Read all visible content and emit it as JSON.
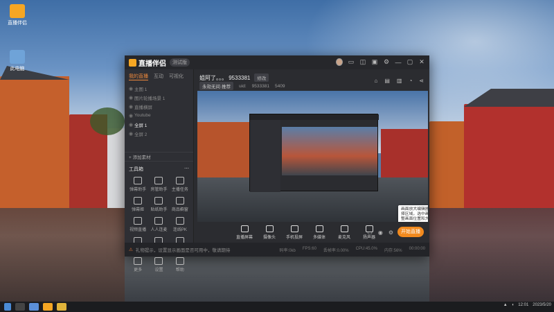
{
  "window": {
    "app_name": "直播伴侣",
    "version_badge": "测试版",
    "tabs": [
      "我的直播",
      "互动",
      "可视化"
    ],
    "scenes": [
      {
        "label": "主图 1",
        "selected": false
      },
      {
        "label": "图片轮播场景 1",
        "selected": false
      },
      {
        "label": "直播横屏",
        "selected": false
      },
      {
        "label": "Youtube",
        "selected": false
      },
      {
        "label": "全屏 1",
        "selected": true
      },
      {
        "label": "全屏 2",
        "selected": false
      }
    ],
    "add_source_label": "+ 添加素材",
    "tools_title": "工具箱",
    "tools": [
      {
        "label": "弹幕助手",
        "icon": "danmu-icon"
      },
      {
        "label": "房管助手",
        "icon": "user-icon"
      },
      {
        "label": "主播任务",
        "icon": "task-icon"
      },
      {
        "label": "弹幕姬",
        "icon": "chat-icon"
      },
      {
        "label": "贴纸助手",
        "icon": "sticker-icon"
      },
      {
        "label": "商品橱窗",
        "icon": "shop-icon"
      },
      {
        "label": "视频直播",
        "icon": "video-icon"
      },
      {
        "label": "人人连麦",
        "icon": "connect-icon"
      },
      {
        "label": "连线PK",
        "icon": "pk-icon"
      },
      {
        "label": "虚拟形象",
        "icon": "avatar-icon"
      },
      {
        "label": "弹幕看",
        "icon": "download-icon"
      },
      {
        "label": "歌词助手",
        "icon": "music-icon"
      },
      {
        "label": "更多",
        "icon": "more-icon"
      },
      {
        "label": "设置",
        "icon": "settings-icon"
      },
      {
        "label": "帮助",
        "icon": "help-icon"
      }
    ],
    "room_title": "姐阿了。。。 9533381",
    "modify_label": "修改",
    "room_category": "永劫无间·推荐",
    "room_uid": "uid:",
    "room_id": "9533381",
    "room_followers": "5409",
    "bottom_tools": [
      {
        "label": "直播屏幕",
        "icon": "screen-icon"
      },
      {
        "label": "摄像头",
        "icon": "camera-icon"
      },
      {
        "label": "手机投屏",
        "icon": "phone-icon"
      },
      {
        "label": "多媒体",
        "icon": "media-icon"
      },
      {
        "label": "麦克风",
        "icon": "mic-icon"
      },
      {
        "label": "扬声器",
        "icon": "speaker-icon"
      }
    ],
    "live_button": "开始直播",
    "status_warning": "礼物提示，设置显示画面是否可用中，敬请期待",
    "stats": [
      "码率:0kb",
      "FPS:60",
      "丢帧率:0.00%",
      "CPU:45.0%",
      "内存:56%",
      "00:00:00"
    ],
    "tooltip_text": "画面放大编辑器，可使用放大工具进行放大选择区域，选中画面区域后可点击编辑，可以调整画面位置和大小。Ctrl+V粘贴文本/图片"
  },
  "desktop": {
    "icons": [
      {
        "label": "直播伴侣",
        "icon": "app-icon"
      },
      {
        "label": "此电脑",
        "icon": "computer-icon"
      }
    ],
    "watermark": "抖音"
  },
  "colors": {
    "accent": "#f28a1e",
    "window_bg": "#2b2c30"
  },
  "taskbar": {
    "clock": "12:01",
    "date": "2023/5/20"
  }
}
